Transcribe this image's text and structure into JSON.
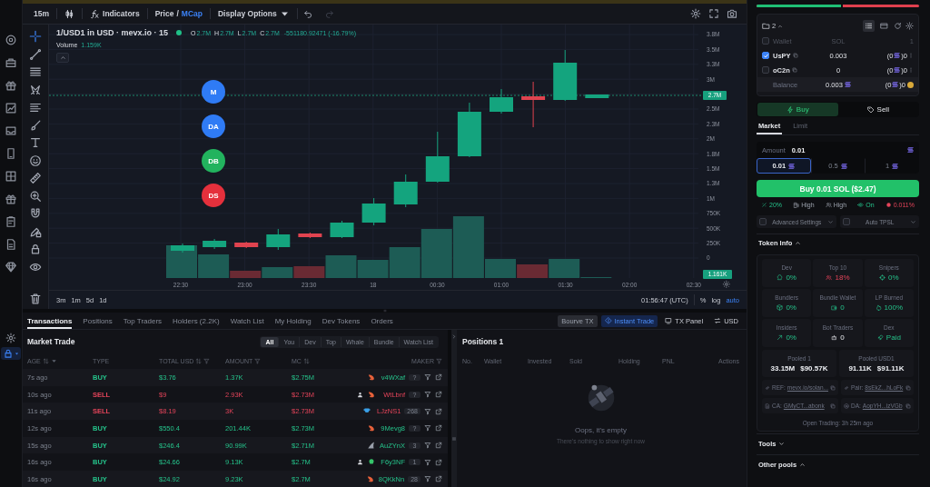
{
  "rail": {
    "top": [
      {
        "selected": false
      },
      {
        "selected": false
      },
      {
        "selected": false
      },
      {
        "selected": false
      },
      {
        "selected": false
      },
      {
        "selected": false
      },
      {
        "selected": false
      },
      {
        "selected": false
      },
      {
        "selected": false
      },
      {
        "selected": false
      },
      {
        "selected": false
      }
    ],
    "bottom": [
      {
        "selected": false
      },
      {
        "selected": true
      }
    ]
  },
  "chart_toolbar": {
    "interval": "15m",
    "indicators": "Indicators",
    "modes": [
      {
        "label": "Price",
        "selected": false
      },
      {
        "label": "MCap",
        "selected": true
      }
    ],
    "mode_separator": "/",
    "display_options": "Display Options",
    "redo_disabled": true
  },
  "drawing_tools": [
    {
      "selected": true
    },
    {
      "selected": false
    },
    {
      "selected": false
    },
    {
      "selected": false
    },
    {
      "selected": false
    },
    {
      "selected": false
    },
    {
      "selected": false
    },
    {
      "selected": false
    },
    {
      "selected": false
    },
    {
      "selected": false
    },
    {
      "selected": false
    },
    {
      "selected": false
    },
    {
      "selected": false
    },
    {
      "selected": false
    }
  ],
  "chart": {
    "symbol": "1/USD1 in USD · mevx.io · 15",
    "ohlc": [
      {
        "key": "O",
        "value": "2.7M"
      },
      {
        "key": "H",
        "value": "2.7M"
      },
      {
        "key": "L",
        "value": "2.7M"
      },
      {
        "key": "C",
        "value": "2.7M"
      }
    ],
    "change": "-551180.92471 (-16.79%)",
    "volume_label": "Volume",
    "volume_value": "1.159K",
    "markers": [
      {
        "label": "M",
        "color": "#2f7bf5"
      },
      {
        "label": "DA",
        "color": "#2f7bf5"
      },
      {
        "label": "DB",
        "color": "#22b35e"
      },
      {
        "label": "DS",
        "color": "#e5303c"
      }
    ],
    "price_labels": [
      "3.8M",
      "3.5M",
      "3.3M",
      "3M",
      "2.5M",
      "2.3M",
      "2M",
      "1.8M",
      "1.5M",
      "1.3M",
      "1M",
      "750K",
      "500K",
      "250K",
      "0"
    ],
    "last_price": "2.7M",
    "last_volume": "1.161K",
    "time_labels": [
      "22:30",
      "23:00",
      "23:30",
      "18",
      "00:30",
      "01:00",
      "01:30",
      "02:00",
      "02:30"
    ]
  },
  "chart_footer": {
    "ranges": [
      "3m",
      "1m",
      "5d",
      "1d"
    ],
    "clock": "01:56:47 (UTC)",
    "scales": [
      {
        "label": "%",
        "selected": false
      },
      {
        "label": "log",
        "selected": false
      },
      {
        "label": "auto",
        "selected": true
      }
    ]
  },
  "bottom_tabs": [
    {
      "label": "Transactions",
      "selected": true
    },
    {
      "label": "Positions",
      "selected": false
    },
    {
      "label": "Top Traders",
      "selected": false
    },
    {
      "label": "Holders (2.2K)",
      "selected": false
    },
    {
      "label": "Watch List",
      "selected": false
    },
    {
      "label": "My Holding",
      "selected": false
    },
    {
      "label": "Dev Tokens",
      "selected": false
    },
    {
      "label": "Orders",
      "selected": false
    }
  ],
  "bottom_actions": [
    {
      "label": "Bourve TX",
      "kind": "plain"
    },
    {
      "label": "Instant Trade",
      "kind": "instant"
    },
    {
      "label": "TX Panel",
      "kind": "panel"
    },
    {
      "label": "USD",
      "kind": "currency"
    }
  ],
  "market_trade": {
    "title": "Market Trade",
    "filters": [
      {
        "label": "All",
        "selected": true
      },
      {
        "label": "You",
        "selected": false
      },
      {
        "label": "Dev",
        "selected": false
      },
      {
        "label": "Top",
        "selected": false
      },
      {
        "label": "Whale",
        "selected": false
      },
      {
        "label": "Bundle",
        "selected": false
      },
      {
        "label": "Watch List",
        "selected": false
      }
    ],
    "columns": [
      {
        "label": "AGE",
        "kind": "sorted"
      },
      {
        "label": "TYPE",
        "kind": "plain"
      },
      {
        "label": "TOTAL USD",
        "kind": "sortfilter"
      },
      {
        "label": "AMOUNT",
        "kind": "filter"
      },
      {
        "label": "MC",
        "kind": "sort"
      },
      {
        "label": "MAKER",
        "kind": "filter"
      }
    ],
    "rows": [
      {
        "age": "7s ago",
        "type": "BUY",
        "kind": "buy",
        "total": "$3.76",
        "amount": "1.37K",
        "mc": "$2.75M",
        "maker": {
          "kind": "shrimp",
          "name": "v4WXaf",
          "user_mark": false,
          "count": "?"
        }
      },
      {
        "age": "10s ago",
        "type": "SELL",
        "kind": "sell",
        "total": "$9",
        "amount": "2.93K",
        "mc": "$2.73M",
        "maker": {
          "kind": "shrimp",
          "name": "WtLbnf",
          "user_mark": true,
          "count": "?"
        }
      },
      {
        "age": "11s ago",
        "type": "SELL",
        "kind": "sell",
        "total": "$8.19",
        "amount": "3K",
        "mc": "$2.73M",
        "maker": {
          "kind": "trophy",
          "name": "LJzNS1",
          "user_mark": false,
          "count": "268"
        }
      },
      {
        "age": "12s ago",
        "type": "BUY",
        "kind": "buy",
        "total": "$550.4",
        "amount": "201.44K",
        "mc": "$2.73M",
        "maker": {
          "kind": "shrimp",
          "name": "9Mevg8",
          "user_mark": false,
          "count": "?"
        }
      },
      {
        "age": "15s ago",
        "type": "BUY",
        "kind": "buy",
        "total": "$246.4",
        "amount": "90.99K",
        "mc": "$2.71M",
        "maker": {
          "kind": "fin",
          "name": "AuZYnX",
          "user_mark": false,
          "count": "3"
        }
      },
      {
        "age": "16s ago",
        "type": "BUY",
        "kind": "buy",
        "total": "$24.66",
        "amount": "9.13K",
        "mc": "$2.7M",
        "maker": {
          "kind": "bulb",
          "name": "F6y3NF",
          "user_mark": true,
          "count": "1"
        }
      },
      {
        "age": "16s ago",
        "type": "BUY",
        "kind": "buy",
        "total": "$24.92",
        "amount": "9.23K",
        "mc": "$2.7M",
        "maker": {
          "kind": "shrimp",
          "name": "8QKkNn",
          "user_mark": false,
          "count": "28"
        }
      }
    ]
  },
  "positions": {
    "title": "Positions 1",
    "columns": [
      "No.",
      "Wallet",
      "Invested",
      "Sold",
      "Holding",
      "PNL",
      "Actions"
    ],
    "empty_title": "Oops, it's empty",
    "empty_text": "There's nothing to show right now"
  },
  "side": {
    "pressure": {
      "level": 0.53
    },
    "wallets": {
      "count": "2",
      "expanded": true,
      "views": [
        {
          "selected": true
        },
        {
          "selected": false
        }
      ],
      "columns": {
        "wallet": "Wallet",
        "sol": "SOL",
        "extra": "1"
      },
      "all_checked": false,
      "rows": [
        {
          "name": "UsPY",
          "sol": "0.003",
          "pre": "(0",
          "post": ")0",
          "checked": true
        },
        {
          "name": "oC2n",
          "sol": "0",
          "pre": "(0",
          "post": ")0",
          "checked": false
        }
      ],
      "balance": {
        "label": "Balance",
        "sol": "0.003",
        "pre": "(0",
        "post": ")0"
      }
    },
    "trade": {
      "sides": [
        {
          "label": "Buy",
          "selected": true
        },
        {
          "label": "Sell",
          "selected": false
        }
      ],
      "order_types": [
        {
          "label": "Market",
          "selected": true
        },
        {
          "label": "Limit",
          "selected": false
        }
      ],
      "amount_label": "Amount",
      "amount": "0.01",
      "presets": [
        {
          "label": "0.01",
          "selected": true
        },
        {
          "label": "0.5",
          "selected": false
        },
        {
          "label": "1",
          "selected": false
        }
      ],
      "submit": "Buy 0.01 SOL ($2.47)",
      "settings": [
        {
          "value": "20%",
          "kind": "good"
        },
        {
          "value": "High",
          "kind": "plain"
        },
        {
          "value": "High",
          "kind": "plain"
        },
        {
          "value": "On",
          "kind": "good"
        },
        {
          "value": "0.011%",
          "kind": "bad"
        }
      ],
      "options": [
        {
          "label": "Advanced Settings",
          "checked": false
        },
        {
          "label": "Auto TPSL",
          "checked": false
        }
      ]
    },
    "token_info": {
      "title": "Token Info",
      "expanded": true,
      "stats": [
        {
          "label": "Dev",
          "value": "0%",
          "kind": "good"
        },
        {
          "label": "Top 10",
          "value": "18%",
          "kind": "bad"
        },
        {
          "label": "Snipers",
          "value": "0%",
          "kind": "good"
        },
        {
          "label": "Bundlers",
          "value": "0%",
          "kind": "good"
        },
        {
          "label": "Bundle Wallet",
          "value": "0",
          "kind": "good"
        },
        {
          "label": "LP Burned",
          "value": "100%",
          "kind": "good"
        },
        {
          "label": "Insiders",
          "value": "0%",
          "kind": "good"
        },
        {
          "label": "Bot Traders",
          "value": "0",
          "kind": "plain"
        },
        {
          "label": "Dex",
          "value": "Paid",
          "kind": "good"
        }
      ],
      "pools": [
        {
          "label": "Pooled 1",
          "amount": "33.15M",
          "usd": "$90.57K"
        },
        {
          "label": "Pooled USD1",
          "amount": "91.11K",
          "usd": "$91.11K"
        }
      ],
      "links": [
        {
          "label": "REF:",
          "value": "mevx.io/solan..."
        },
        {
          "label": "Pair:",
          "value": "8sEkZ...hLoFk"
        },
        {
          "label": "CA:",
          "value": "GMyCT...abonk"
        },
        {
          "label": "DA:",
          "value": "AopYH...izVGb"
        }
      ],
      "open_trading": "Open Trading: 3h 25m ago"
    },
    "sections": [
      {
        "title": "Tools",
        "expanded": false
      },
      {
        "title": "Other pools",
        "expanded": true
      }
    ]
  }
}
